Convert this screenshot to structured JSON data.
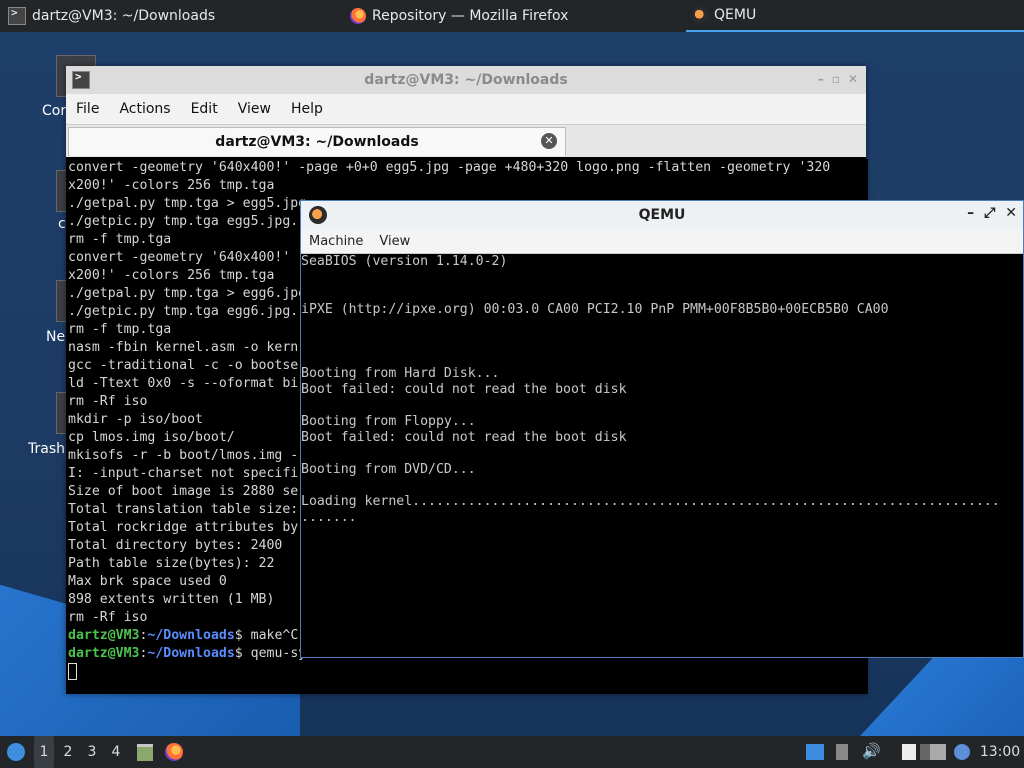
{
  "taskbar": {
    "tasks": [
      {
        "label": "dartz@VM3: ~/Downloads",
        "icon": "terminal-icon"
      },
      {
        "label": "Repository — Mozilla Firefox",
        "icon": "firefox-icon"
      },
      {
        "label": "QEMU",
        "icon": "qemu-icon"
      }
    ]
  },
  "desktop_icons": [
    "Cor",
    "c",
    "Ne",
    "Trash"
  ],
  "terminal": {
    "window_title": "dartz@VM3: ~/Downloads",
    "menu": [
      "File",
      "Actions",
      "Edit",
      "View",
      "Help"
    ],
    "tab_title": "dartz@VM3: ~/Downloads",
    "lines": [
      "convert -geometry '640x400!' -page +0+0 egg5.jpg -page +480+320 logo.png -flatten -geometry '320",
      "x200!' -colors 256 tmp.tga",
      "./getpal.py tmp.tga > egg5.jpg",
      "./getpic.py tmp.tga egg5.jpg.",
      "rm -f tmp.tga",
      "convert -geometry '640x400!'",
      "x200!' -colors 256 tmp.tga",
      "./getpal.py tmp.tga > egg6.jpg",
      "./getpic.py tmp.tga egg6.jpg.",
      "rm -f tmp.tga",
      "nasm -fbin kernel.asm -o kern",
      "gcc -traditional -c -o bootse",
      "ld -Ttext 0x0 -s --oformat bi",
      "rm -Rf iso",
      "mkdir -p iso/boot",
      "cp lmos.img iso/boot/",
      "mkisofs -r -b boot/lmos.img -",
      "I: -input-charset not specifi",
      "Size of boot image is 2880 se",
      "Total translation table size:",
      "Total rockridge attributes by",
      "Total directory bytes: 2400",
      "Path table size(bytes): 22",
      "Max brk space used 0",
      "898 extents written (1 MB)",
      "rm -Rf iso"
    ],
    "prompts": [
      {
        "user": "dartz@VM3",
        "path": "~/Downloads",
        "cmd": "make^C"
      },
      {
        "user": "dartz@VM3",
        "path": "~/Downloads",
        "cmd": "qemu-system-i386 -cdrom lmos.iso -m 16M"
      }
    ]
  },
  "qemu": {
    "title": "QEMU",
    "menu": [
      "Machine",
      "View"
    ],
    "screen_lines": [
      "SeaBIOS (version 1.14.0-2)",
      "",
      "",
      "iPXE (http://ipxe.org) 00:03.0 CA00 PCI2.10 PnP PMM+00F8B5B0+00ECB5B0 CA00",
      "",
      "",
      "",
      "Booting from Hard Disk...",
      "Boot failed: could not read the boot disk",
      "",
      "Booting from Floppy...",
      "Boot failed: could not read the boot disk",
      "",
      "Booting from DVD/CD...",
      "",
      "Loading kernel..........................................................................",
      "......."
    ]
  },
  "panel": {
    "workspaces": [
      "1",
      "2",
      "3",
      "4"
    ],
    "active_workspace": "1",
    "clock": "13:00"
  },
  "colors": {
    "accent": "#4aa3f0",
    "prompt_user": "#4ec24e",
    "prompt_path": "#5a8cff",
    "desktop": "#1d3a63"
  }
}
